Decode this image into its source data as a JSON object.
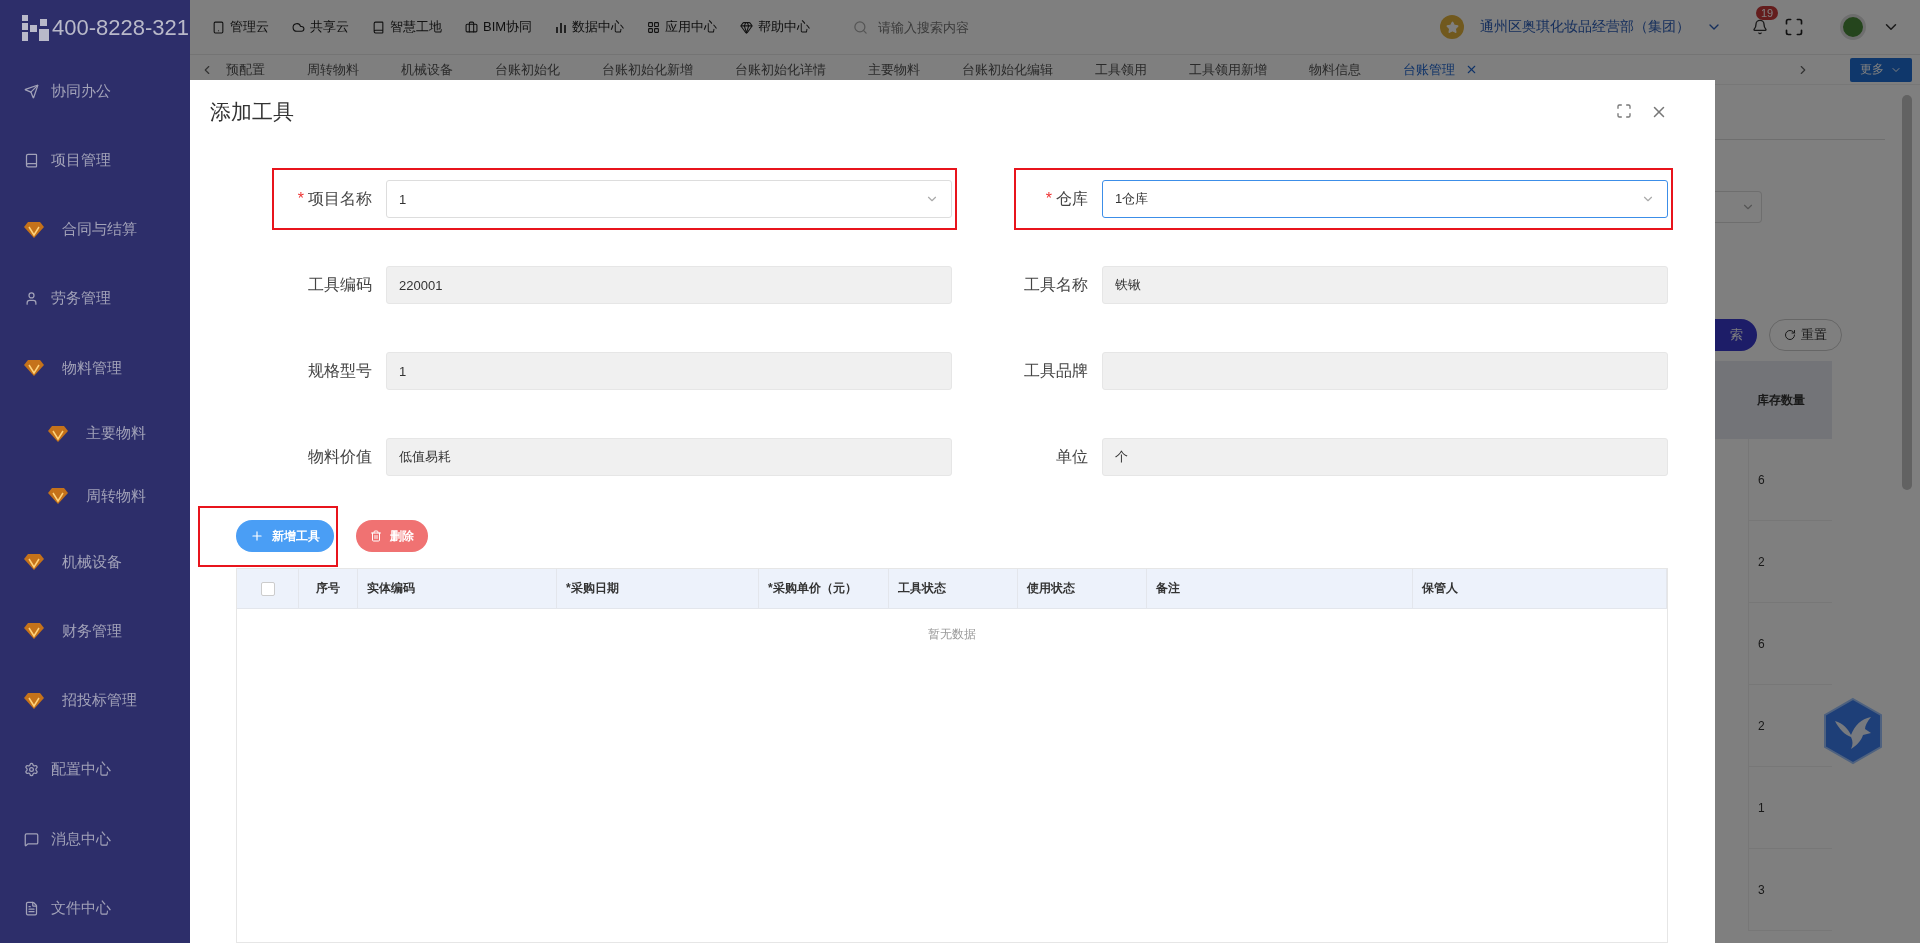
{
  "sidebar": {
    "phone": "400-8228-321",
    "items": [
      {
        "label": "协同办公",
        "kind": "line"
      },
      {
        "label": "项目管理",
        "kind": "line"
      },
      {
        "label": "合同与结算",
        "kind": "gem"
      },
      {
        "label": "劳务管理",
        "kind": "line"
      },
      {
        "label": "物料管理",
        "kind": "gem",
        "children": [
          {
            "label": "主要物料",
            "kind": "gem"
          },
          {
            "label": "周转物料",
            "kind": "gem"
          }
        ]
      },
      {
        "label": "机械设备",
        "kind": "gem"
      },
      {
        "label": "财务管理",
        "kind": "gem"
      },
      {
        "label": "招投标管理",
        "kind": "gem"
      },
      {
        "label": "配置中心",
        "kind": "line"
      },
      {
        "label": "消息中心",
        "kind": "line"
      },
      {
        "label": "文件中心",
        "kind": "line"
      }
    ]
  },
  "header": {
    "nav": [
      "管理云",
      "共享云",
      "智慧工地",
      "BIM协同",
      "数据中心",
      "应用中心",
      "帮助中心"
    ],
    "search": {
      "placeholder": "请输入搜索内容"
    },
    "org": "通州区奥琪化妆品经营部（集团）",
    "notifications": "19"
  },
  "tabs": {
    "items": [
      {
        "label": "预配置",
        "selected": false
      },
      {
        "label": "周转物料",
        "selected": false
      },
      {
        "label": "机械设备",
        "selected": false
      },
      {
        "label": "台账初始化",
        "selected": false
      },
      {
        "label": "台账初始化新增",
        "selected": false
      },
      {
        "label": "台账初始化详情",
        "selected": false
      },
      {
        "label": "主要物料",
        "selected": false
      },
      {
        "label": "台账初始化编辑",
        "selected": false
      },
      {
        "label": "工具领用",
        "selected": false
      },
      {
        "label": "工具领用新增",
        "selected": false
      },
      {
        "label": "物料信息",
        "selected": false
      },
      {
        "label": "台账管理",
        "selected": true
      }
    ],
    "more": "更多"
  },
  "background": {
    "search_button": "索",
    "reset_button": "重置",
    "column": "库存数量",
    "values": [
      "6",
      "2",
      "6",
      "2",
      "1",
      "3"
    ]
  },
  "dialog": {
    "title": "添加工具",
    "fields": [
      {
        "label": "项目名称",
        "value": "1",
        "kind": "select",
        "required_mark": "*",
        "focused": false,
        "highlighted": true
      },
      {
        "label": "仓库",
        "value": "1仓库",
        "kind": "select",
        "required_mark": "*",
        "focused": true,
        "highlighted": true
      },
      {
        "label": "工具编码",
        "value": "220001",
        "kind": "readonly",
        "focused": false,
        "highlighted": false
      },
      {
        "label": "工具名称",
        "value": "铁锹",
        "kind": "readonly",
        "focused": false,
        "highlighted": false
      },
      {
        "label": "规格型号",
        "value": "1",
        "kind": "readonly",
        "focused": false,
        "highlighted": false
      },
      {
        "label": "工具品牌",
        "kind": "readonly",
        "focused": false,
        "highlighted": false
      },
      {
        "label": "物料价值",
        "value": "低值易耗",
        "kind": "readonly",
        "focused": false,
        "highlighted": false
      },
      {
        "label": "单位",
        "value": "个",
        "kind": "readonly",
        "focused": false,
        "highlighted": false
      }
    ],
    "buttons": [
      {
        "label": "新增工具",
        "kind": "add",
        "highlighted": true
      },
      {
        "label": "删除",
        "kind": "delete",
        "highlighted": false
      }
    ],
    "table": {
      "select_all": {
        "checked": false
      },
      "columns": [
        "序号",
        "实体编码",
        "*采购日期",
        "*采购单价（元）",
        "工具状态",
        "使用状态",
        "备注",
        "保管人"
      ],
      "empty_text": "暂无数据"
    }
  }
}
